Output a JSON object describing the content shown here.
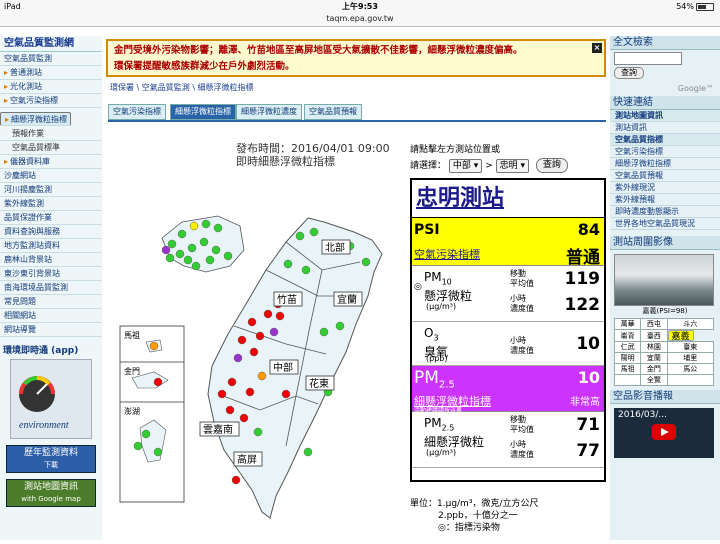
{
  "status": {
    "carrier": "iPad",
    "time": "上午9:53",
    "battery": "54%"
  },
  "url": "taqm.epa.gov.tw",
  "left_sidebar": {
    "header": "空氣品質監測網",
    "items": [
      {
        "label": "空氣品質監測",
        "type": "section"
      },
      {
        "label": "普通測站",
        "type": "arrow"
      },
      {
        "label": "光化測站",
        "type": "arrow"
      },
      {
        "label": "空氣污染指標",
        "type": "arrow"
      },
      {
        "label": "細懸浮微粒指標",
        "type": "arrow"
      },
      {
        "label": "預報作業",
        "type": "sub"
      },
      {
        "label": "空氣品質標準",
        "type": "sub"
      },
      {
        "label": "儀器資料庫",
        "type": "arrow"
      },
      {
        "label": "沙塵網站",
        "type": "section"
      },
      {
        "label": "河川揚塵監測",
        "type": "section"
      },
      {
        "label": "紫外線監測",
        "type": "section"
      },
      {
        "label": "品質保證作業",
        "type": "section"
      },
      {
        "label": "資料查詢與服務",
        "type": "section"
      },
      {
        "label": "地方監測站資料",
        "type": "section"
      },
      {
        "label": "鹿林山背景站",
        "type": "section"
      },
      {
        "label": "東沙東引背景站",
        "type": "section"
      },
      {
        "label": "南海環境品質監測",
        "type": "section"
      },
      {
        "label": "常見問題",
        "type": "section"
      },
      {
        "label": "相關網站",
        "type": "section"
      },
      {
        "label": "網站導覽",
        "type": "section"
      }
    ],
    "app_title": "環境即時通 (app)",
    "app_logo_text": "environment",
    "promo1": {
      "line1": "歷年監測資料",
      "line2": "下載"
    },
    "promo2": {
      "line1": "測站地圖資訊",
      "line2": "with Google map"
    }
  },
  "alert": {
    "line1": "金門受境外污染物影響；離澤、竹苗地區至高屏地區受大氣擴散不佳影響，細懸浮微粒濃度偏高。",
    "line2": "環保署提醒敏感族群減少在戶外劇烈活動。",
    "close": "×"
  },
  "breadcrumb": "環保署 \\ 空氣品質監測 \\ 細懸浮微粒指標",
  "tabs": [
    "空氣污染指標",
    "細懸浮微粒指標",
    "細懸浮微粒濃度",
    "空氣品質預報"
  ],
  "active_tab": 1,
  "publish": {
    "time": "發布時間：2016/04/01 09:00",
    "subtitle": "即時細懸浮微粒指標"
  },
  "map": {
    "region_labels": [
      "北部",
      "竹苗",
      "宜蘭",
      "中部",
      "花東",
      "雲嘉南",
      "高屏"
    ],
    "island_labels": [
      "馬祖",
      "金門",
      "澎湖"
    ],
    "colors": {
      "green": "#33cc33",
      "yellow": "#ffee00",
      "orange": "#ff9900",
      "red": "#ee0000",
      "purple": "#9933cc",
      "land": "#e8f4f8",
      "border": "#555"
    }
  },
  "selector": {
    "prompt": "請點擊左方測站位置或",
    "label": "請選擇：",
    "region": "中部",
    "sep": ">",
    "station": "忠明",
    "button": "查詢"
  },
  "station": {
    "name": "忠明測站",
    "psi": {
      "label": "PSI",
      "value": "84",
      "name": "空氣污染指標",
      "status": "普通"
    },
    "pm10": {
      "name_main": "PM",
      "name_sub": "10",
      "name_cn": "懸浮微粒",
      "unit": "(μg/m³)",
      "label1a": "移動",
      "label1b": "平均值",
      "value1": "119",
      "label2a": "小時",
      "label2b": "濃度值",
      "value2": "122"
    },
    "o3": {
      "name_main": "O",
      "name_sub": "3",
      "name_cn": "臭氧",
      "unit": "(ppb)",
      "label_a": "小時",
      "label_b": "濃度值",
      "value": "10"
    },
    "pm25": {
      "label_main": "PM",
      "label_sub": "2.5",
      "value": "10",
      "name": "細懸浮微粒指標",
      "status": "非常高",
      "link": "活動建議請按這裏"
    },
    "pm25_conc": {
      "name_main": "PM",
      "name_sub": "2.5",
      "name_cn": "細懸浮微粒",
      "unit": "(μg/m³)",
      "label1a": "移動",
      "label1b": "平均值",
      "value1": "71",
      "label2a": "小時",
      "label2b": "濃度值",
      "value2": "77"
    }
  },
  "units_note": {
    "line1": "單位：1.μg/m³，微克/立方公尺",
    "line2": "2.ppb，十億分之一",
    "line3": "◎：指標污染物"
  },
  "right_sidebar": {
    "search_title": "全文檢索",
    "search_button": "查詢",
    "google": "Google™",
    "quick_title": "快速連結",
    "links": [
      {
        "label": "測站地圖資訊",
        "bold": true
      },
      {
        "label": "測站資訊",
        "bold": false
      },
      {
        "label": "空氣品質指標",
        "bold": true
      },
      {
        "label": "空氣污染指標",
        "bold": false
      },
      {
        "label": "細懸浮微粒指標",
        "bold": false
      },
      {
        "label": "空氣品質預報",
        "bold": false
      },
      {
        "label": "紫外線現況",
        "bold": false
      },
      {
        "label": "紫外線預報",
        "bold": false
      },
      {
        "label": "即時濃度動態顯示",
        "bold": false
      },
      {
        "label": "世界各地空氣品質現況",
        "bold": false
      }
    ],
    "cam_title": "測站周圍影像",
    "cam_caption": "嘉義(PSI=98)",
    "grid": [
      [
        "萬華",
        "西屯",
        "斗六"
      ],
      [
        "崙背",
        "臺西",
        "嘉義"
      ],
      [
        "仁武",
        "林園",
        "臺東"
      ],
      [
        "陽明",
        "宜蘭",
        "埔里"
      ],
      [
        "馬祖",
        "金門",
        "馬公"
      ],
      [
        "",
        "全覽",
        ""
      ]
    ],
    "grid_selected": "嘉義",
    "video_title": "空品影音播報",
    "video_caption": "2016/03/..."
  }
}
